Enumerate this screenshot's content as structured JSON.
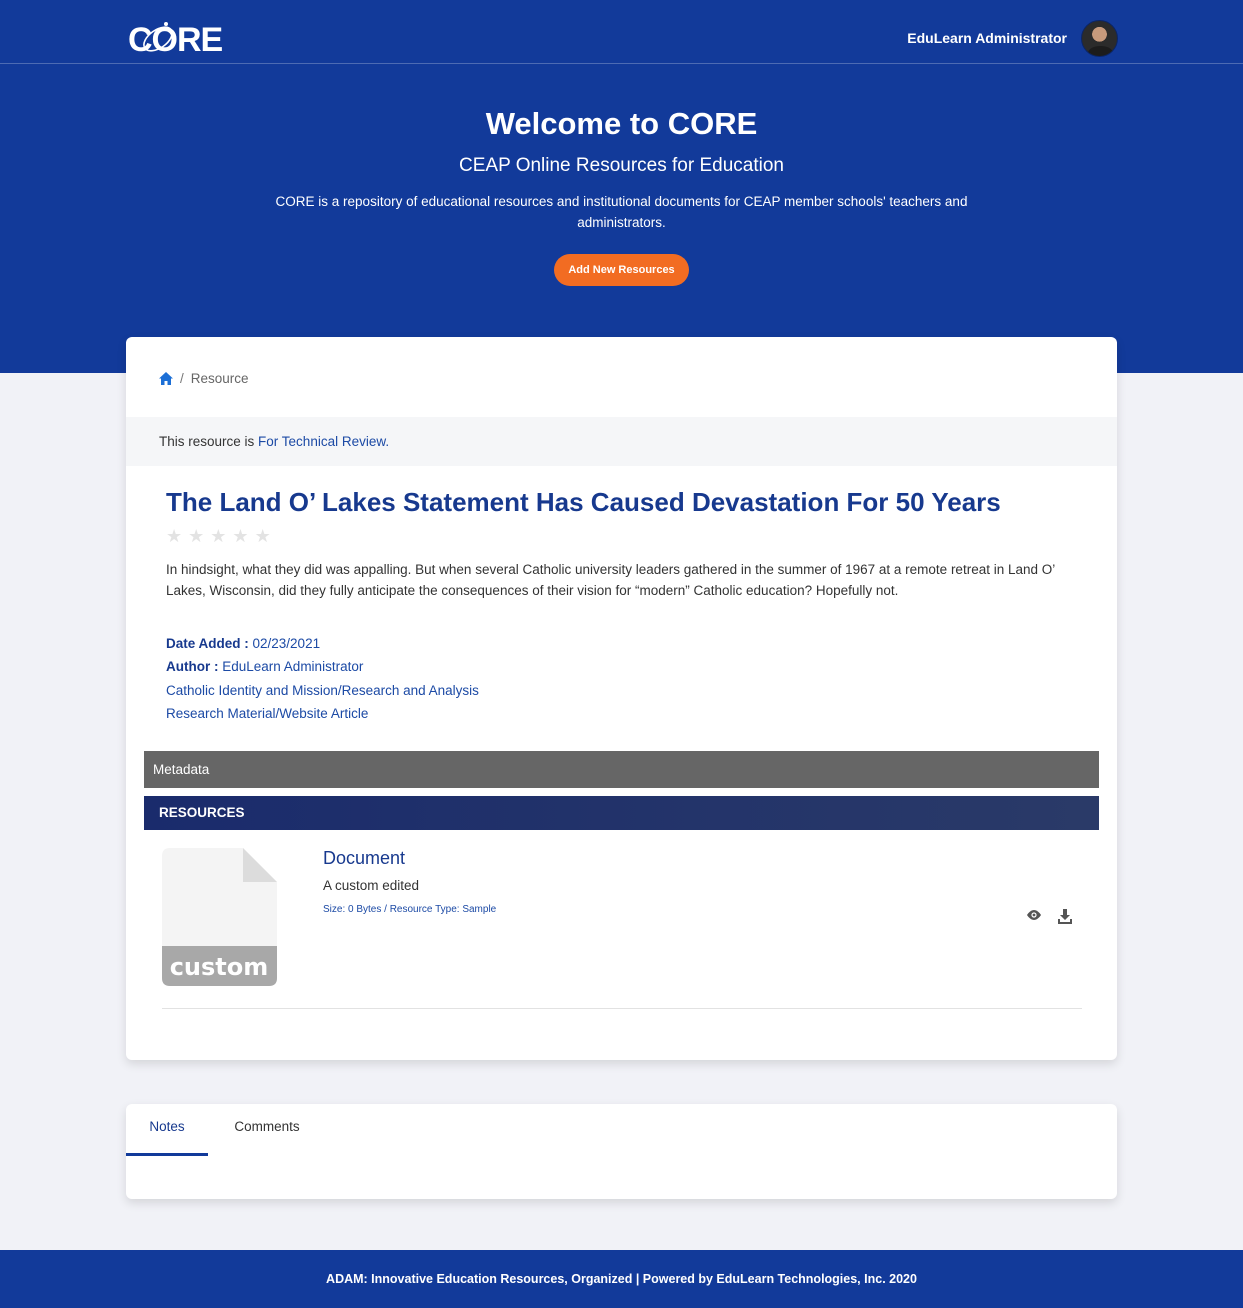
{
  "header": {
    "logo_text": "CORE",
    "user_name": "EduLearn Administrator"
  },
  "hero": {
    "title": "Welcome to CORE",
    "subtitle": "CEAP Online Resources for Education",
    "description": "CORE is a repository of educational resources and institutional documents for CEAP member schools' teachers and administrators.",
    "add_button_label": "Add New Resources"
  },
  "breadcrumb": {
    "separator": "/",
    "current": "Resource"
  },
  "status": {
    "prefix": "This resource is",
    "value": "For Technical Review."
  },
  "resource": {
    "title": "The Land O’ Lakes Statement Has Caused Devastation For 50 Years",
    "rating": 0,
    "rating_max": 5,
    "description": "In hindsight, what they did was appalling. But when several Catholic university leaders gathered in the summer of 1967 at a remote retreat in Land O’ Lakes, Wisconsin, did they fully anticipate the consequences of their vision for “modern” Catholic education? Hopefully not.",
    "date_added_label": "Date Added",
    "date_added": "02/23/2021",
    "author_label": "Author",
    "author": "EduLearn Administrator",
    "category": "Catholic Identity and Mission/Research and Analysis",
    "type": "Research Material/Website Article"
  },
  "sections": {
    "metadata_label": "Metadata",
    "resources_label": "RESOURCES"
  },
  "document": {
    "icon_label": "custom",
    "title": "Document",
    "description": "A custom edited",
    "size_info": "Size: 0 Bytes / Resource Type: Sample"
  },
  "tabs": [
    {
      "label": "Notes",
      "active": true
    },
    {
      "label": "Comments",
      "active": false
    }
  ],
  "footer": {
    "text": "ADAM: Innovative Education Resources, Organized | Powered by EduLearn Technologies, Inc. 2020"
  },
  "colors": {
    "primary": "#123a9a",
    "accent": "#f26c22",
    "link": "#1c4aa5",
    "metadata_bar": "#666666"
  }
}
